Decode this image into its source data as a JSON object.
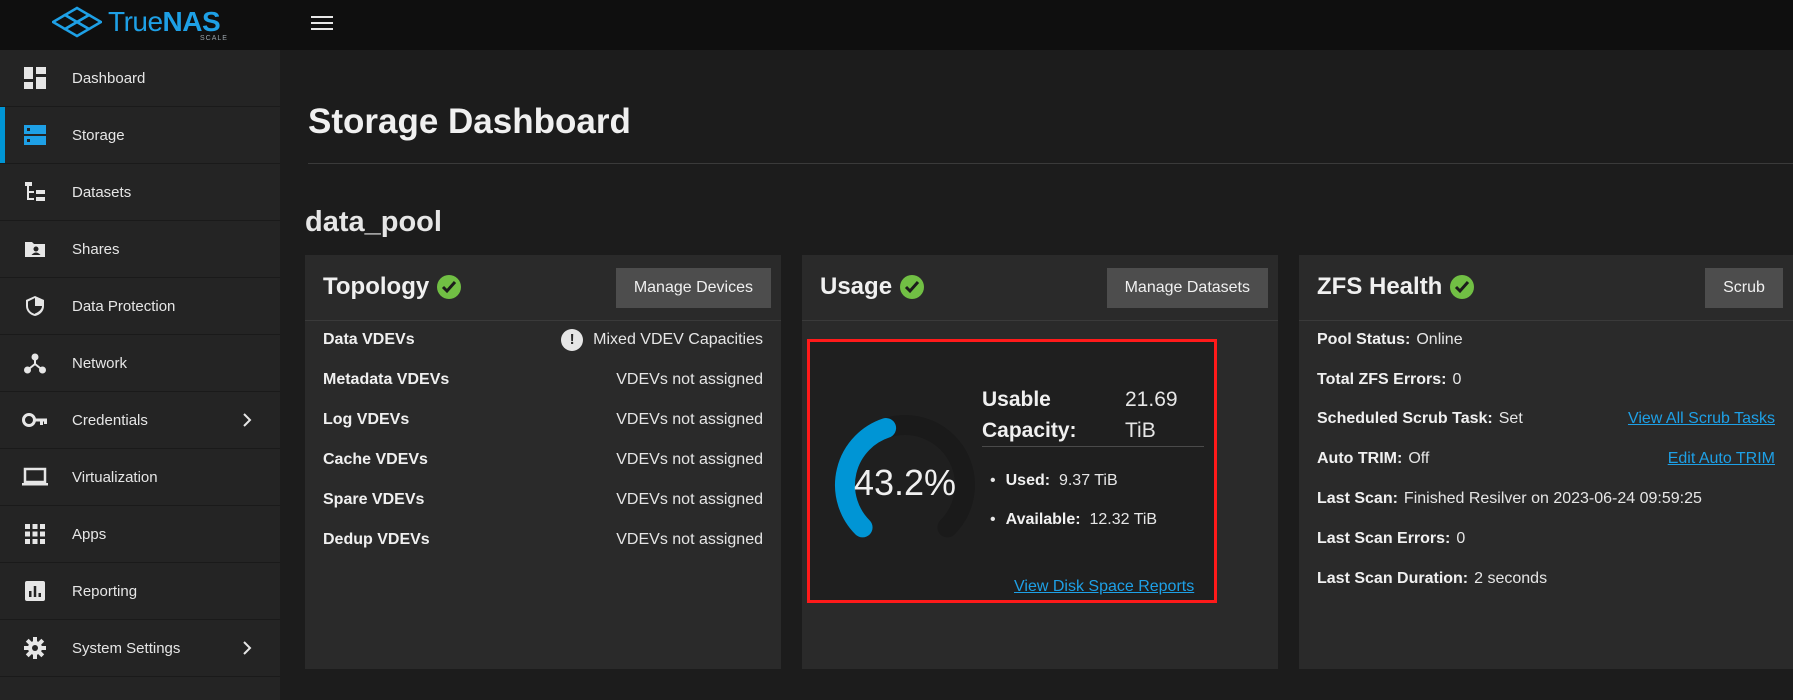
{
  "header": {
    "logo_text_a": "True",
    "logo_text_b": "NAS",
    "logo_sub": "SCALE",
    "menu_icon": "hamburger-icon"
  },
  "sidebar": {
    "items": [
      {
        "label": "Dashboard",
        "icon": "dashboard-icon"
      },
      {
        "label": "Storage",
        "icon": "storage-icon"
      },
      {
        "label": "Datasets",
        "icon": "datasets-icon"
      },
      {
        "label": "Shares",
        "icon": "shares-icon"
      },
      {
        "label": "Data Protection",
        "icon": "shield-icon"
      },
      {
        "label": "Network",
        "icon": "network-icon"
      },
      {
        "label": "Credentials",
        "icon": "key-icon"
      },
      {
        "label": "Virtualization",
        "icon": "laptop-icon"
      },
      {
        "label": "Apps",
        "icon": "apps-grid-icon"
      },
      {
        "label": "Reporting",
        "icon": "reporting-icon"
      },
      {
        "label": "System Settings",
        "icon": "gear-icon"
      }
    ],
    "active": "Storage"
  },
  "main": {
    "title": "Storage Dashboard",
    "pool_name": "data_pool"
  },
  "topology": {
    "title": "Topology",
    "button": "Manage Devices",
    "rows": [
      {
        "label": "Data VDEVs",
        "value": "Mixed VDEV Capacities",
        "warning": true
      },
      {
        "label": "Metadata VDEVs",
        "value": "VDEVs not assigned"
      },
      {
        "label": "Log VDEVs",
        "value": "VDEVs not assigned"
      },
      {
        "label": "Cache VDEVs",
        "value": "VDEVs not assigned"
      },
      {
        "label": "Spare VDEVs",
        "value": "VDEVs not assigned"
      },
      {
        "label": "Dedup VDEVs",
        "value": "VDEVs not assigned"
      }
    ],
    "warning_glyph": "!"
  },
  "usage": {
    "title": "Usage",
    "button": "Manage Datasets",
    "percent_text": "43.2%",
    "percent_value": 43.2,
    "capacity_label_1": "Usable",
    "capacity_label_2": "Capacity:",
    "capacity_value_1": "21.69",
    "capacity_value_2": "TiB",
    "used_label": "Used:",
    "used_value": "9.37 TiB",
    "available_label": "Available:",
    "available_value": "12.32 TiB",
    "link": "View Disk Space Reports",
    "colors": {
      "gauge_fill": "#0095d5",
      "gauge_track": "#1a1a1a",
      "highlight": "#ff1a1a"
    }
  },
  "zfs": {
    "title": "ZFS Health",
    "button": "Scrub",
    "rows": [
      {
        "label": "Pool Status:",
        "value": "Online"
      },
      {
        "label": "Total ZFS Errors:",
        "value": "0"
      },
      {
        "label": "Scheduled Scrub Task:",
        "value": "Set",
        "link": "View All Scrub Tasks"
      },
      {
        "label": "Auto TRIM:",
        "value": "Off",
        "link": "Edit Auto TRIM"
      },
      {
        "label": "Last Scan:",
        "value": "Finished Resilver on 2023-06-24 09:59:25"
      },
      {
        "label": "Last Scan Errors:",
        "value": "0"
      },
      {
        "label": "Last Scan Duration:",
        "value": "2 seconds"
      }
    ]
  },
  "colors": {
    "accent": "#0095d5",
    "healthy": "#71bf44",
    "link": "#1ea0e6"
  }
}
